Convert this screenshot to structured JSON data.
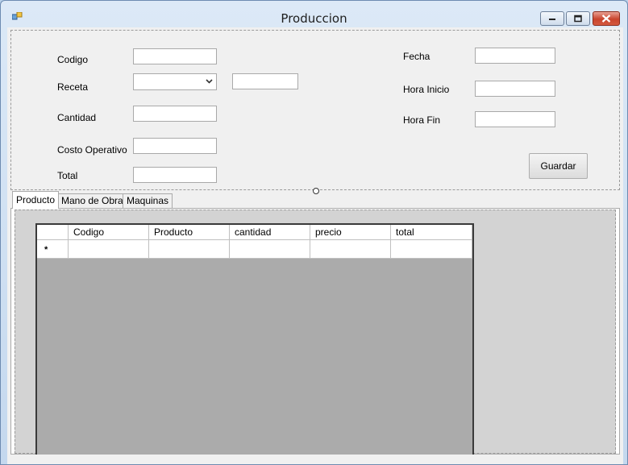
{
  "window": {
    "title": "Produccion",
    "icons": {
      "app": "form-app-icon",
      "minimize": "minimize-icon",
      "maximize": "maximize-icon",
      "close": "close-icon"
    },
    "colors": {
      "close_button": "#c9442d",
      "frame": "#dce9f7"
    }
  },
  "form": {
    "codigo_label": "Codigo",
    "codigo_value": "",
    "receta_label": "Receta",
    "receta_selected": "",
    "receta_extra_value": "",
    "cantidad_label": "Cantidad",
    "cantidad_value": "",
    "costo_label": "Costo Operativo",
    "costo_value": "",
    "total_label": "Total",
    "total_value": "",
    "fecha_label": "Fecha",
    "fecha_value": "",
    "hora_inicio_label": "Hora Inicio",
    "hora_inicio_value": "",
    "hora_fin_label": "Hora Fin",
    "hora_fin_value": "",
    "guardar_label": "Guardar"
  },
  "tabs": [
    {
      "label": "Producto",
      "active": true
    },
    {
      "label": "Mano de Obra",
      "active": false
    },
    {
      "label": "Maquinas",
      "active": false
    }
  ],
  "grid": {
    "columns": [
      "Codigo",
      "Producto",
      "cantidad",
      "precio",
      "total"
    ],
    "new_row_marker": "*"
  }
}
